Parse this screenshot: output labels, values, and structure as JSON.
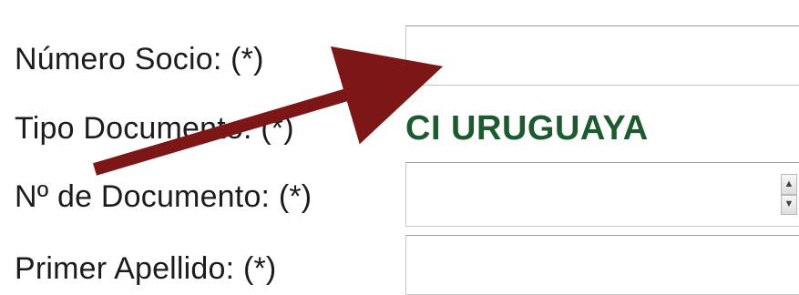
{
  "form": {
    "numero_socio_label": "Número Socio: (*)",
    "tipo_documento_label": "Tipo Documento: (*)",
    "tipo_documento_value": "CI URUGUAYA",
    "numero_documento_label": "Nº de Documento: (*)",
    "primer_apellido_label": "Primer Apellido: (*)",
    "numero_socio_value": "",
    "numero_documento_value": "",
    "primer_apellido_value": ""
  },
  "icons": {
    "spinner_up": "▲",
    "spinner_down": "▼"
  },
  "colors": {
    "document_type": "#1e5a2f",
    "annotation_arrow": "#7d1717"
  }
}
